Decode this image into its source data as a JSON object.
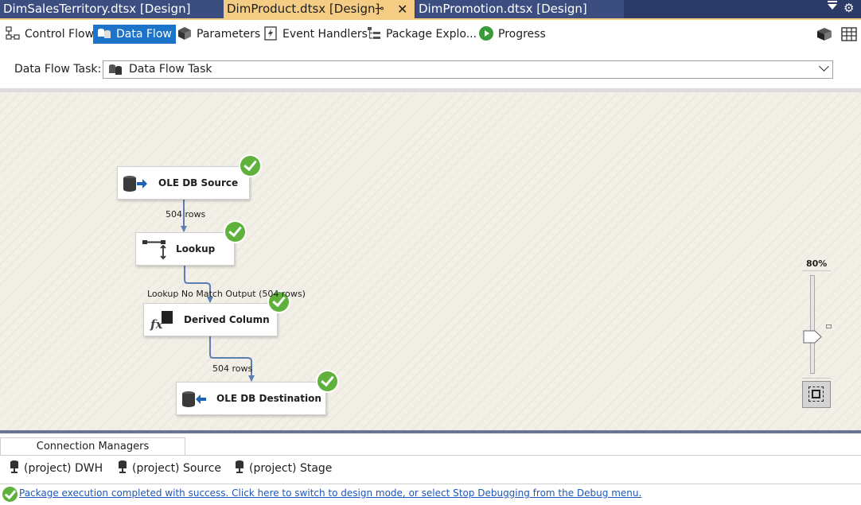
{
  "doc_tabs": [
    {
      "label": "DimSalesTerritory.dtsx [Design]"
    },
    {
      "label": "DimProduct.dtsx [Design]",
      "pin_icon": "pin-icon",
      "close_icon": "close-icon"
    },
    {
      "label": "DimPromotion.dtsx [Design]"
    }
  ],
  "toolbar": {
    "control_flow": "Control Flow",
    "data_flow": "Data Flow",
    "parameters": "Parameters",
    "event_handlers": "Event Handlers",
    "package_explorer": "Package Explo...",
    "progress": "Progress"
  },
  "task_selector": {
    "label": "Data Flow Task:",
    "value": "Data Flow Task"
  },
  "canvas": {
    "nodes": {
      "ole_db_source": "OLE DB Source",
      "lookup": "Lookup",
      "derived_column": "Derived Column",
      "ole_db_destination": "OLE DB Destination"
    },
    "paths": {
      "source_to_lookup": "504 rows",
      "lookup_to_derived": "Lookup No Match Output (504 rows)",
      "derived_to_destination": "504 rows"
    },
    "zoom": "80%"
  },
  "connection_managers": {
    "tab_label": "Connection Managers",
    "items": [
      "(project) DWH",
      "(project) Source",
      "(project) Stage"
    ]
  },
  "status": {
    "message": "Package execution completed with success. Click here to switch to design mode, or select Stop Debugging from the Debug menu."
  },
  "colors": {
    "active_tab": "#f5cc84",
    "tab_bar": "#2b3a66",
    "selected_button": "#1c73c9",
    "success": "#5fb13c",
    "path_line": "#5b7fb5"
  }
}
